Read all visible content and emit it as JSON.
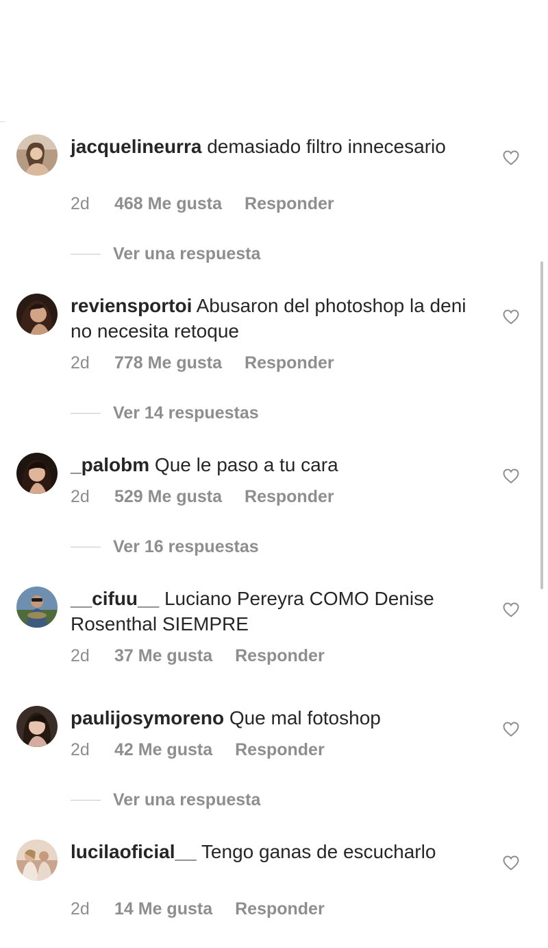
{
  "comments": [
    {
      "username": "jacquelineurra",
      "text": "demasiado  filtro innecesario",
      "time": "2d",
      "likes": "468 Me gusta",
      "reply": "Responder",
      "view_replies": "Ver una respuesta"
    },
    {
      "username": "reviensportoi",
      "text": "Abusaron del photoshop la deni no necesita retoque",
      "time": "2d",
      "likes": "778 Me gusta",
      "reply": "Responder",
      "view_replies": "Ver 14 respuestas"
    },
    {
      "username": "_palobm",
      "text": "Que le paso a tu cara",
      "time": "2d",
      "likes": "529 Me gusta",
      "reply": "Responder",
      "view_replies": "Ver 16 respuestas"
    },
    {
      "username": "__cifuu__",
      "text": "Luciano Pereyra COMO Denise Rosenthal SIEMPRE",
      "time": "2d",
      "likes": "37 Me gusta",
      "reply": "Responder"
    },
    {
      "username": "paulijosymoreno",
      "text": "Que mal fotoshop",
      "time": "2d",
      "likes": "42 Me gusta",
      "reply": "Responder",
      "view_replies": "Ver una respuesta"
    },
    {
      "username": "lucilaoficial__",
      "text": "Tengo ganas de escucharlo",
      "time": "2d",
      "likes": "14 Me gusta",
      "reply": "Responder"
    }
  ]
}
